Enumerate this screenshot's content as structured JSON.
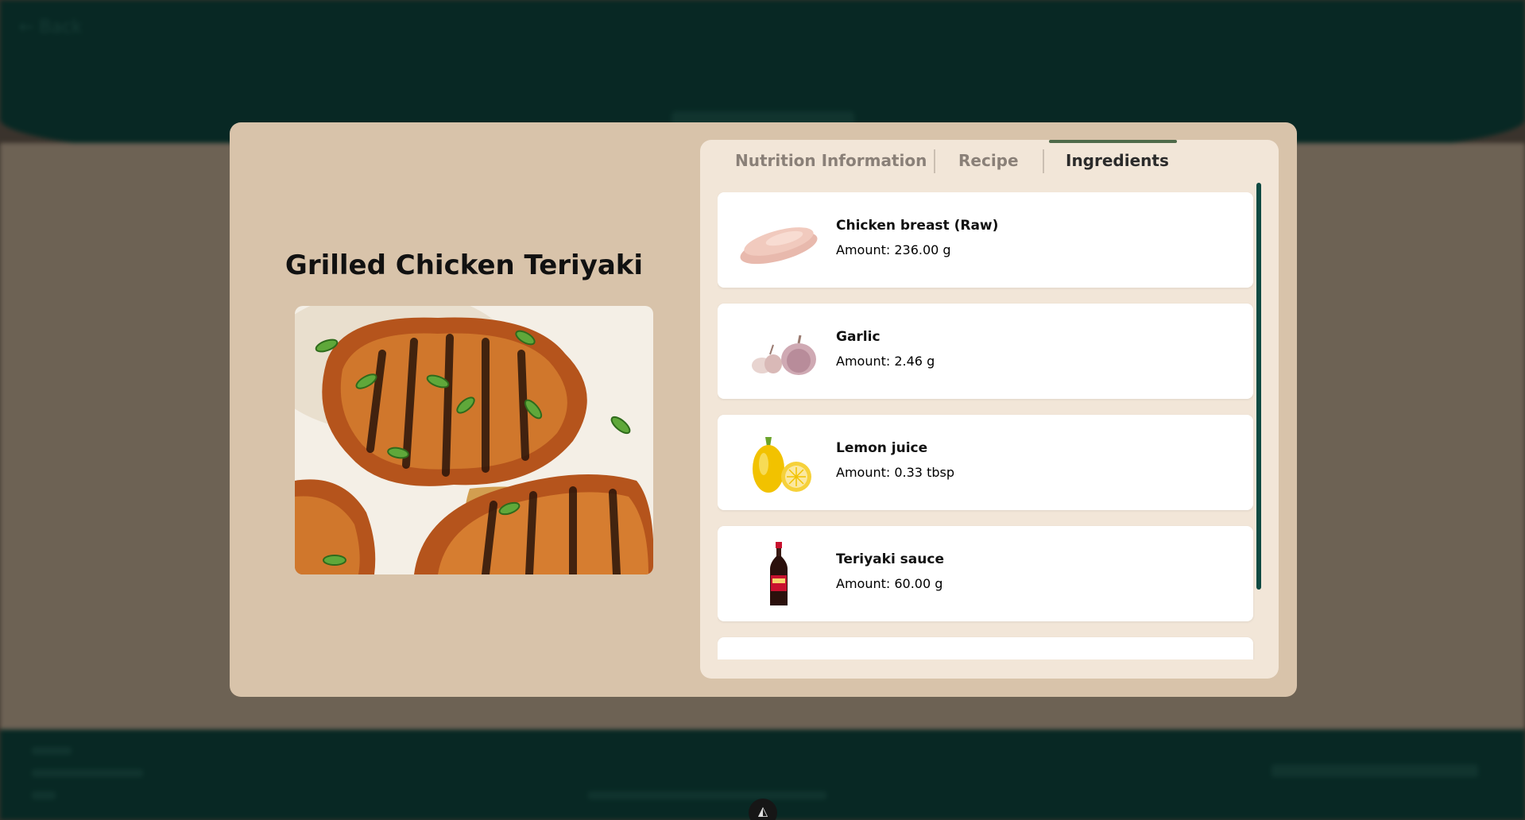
{
  "background": {
    "back_label": "← Back",
    "header_color": "#0f4a42",
    "body_color": "#c7b29a"
  },
  "modal": {
    "title": "Grilled Chicken Teriyaki",
    "tabs": [
      {
        "label": "Nutrition Information",
        "active": false
      },
      {
        "label": "Recipe",
        "active": false
      },
      {
        "label": "Ingredients",
        "active": true
      }
    ],
    "ingredients": [
      {
        "name": "Chicken breast (Raw)",
        "amount": "Amount: 236.00 g",
        "icon": "chicken-breast-icon"
      },
      {
        "name": "Garlic",
        "amount": "Amount: 2.46 g",
        "icon": "garlic-icon"
      },
      {
        "name": "Lemon juice",
        "amount": "Amount: 0.33 tbsp",
        "icon": "lemon-icon"
      },
      {
        "name": "Teriyaki sauce",
        "amount": "Amount: 60.00 g",
        "icon": "sauce-bottle-icon"
      }
    ]
  },
  "colors": {
    "modal_bg": "#d8c3aa",
    "panel_bg": "#f2e6d8",
    "accent": "#0f4a42",
    "tab_indicator": "#4f6a4a"
  }
}
